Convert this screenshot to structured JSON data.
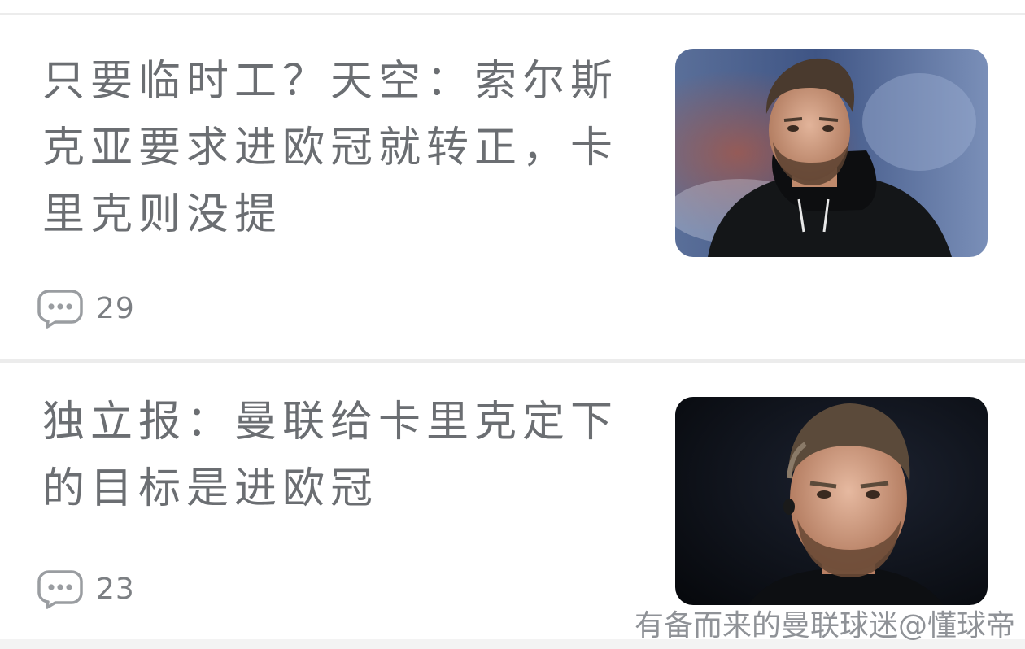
{
  "feed": {
    "items": [
      {
        "title": "只要临时工？天空：索尔斯克亚要求进欧冠就转正，卡里克则没提",
        "comment_count": "29",
        "thumbnail": "man-in-black-hooded-jacket-stadium-photo"
      },
      {
        "title": "独立报：曼联给卡里克定下的目标是进欧冠",
        "comment_count": "23",
        "thumbnail": "man-with-earpiece-dark-background-photo"
      }
    ]
  },
  "watermark": {
    "text": "有备而来的曼联球迷@懂球帝"
  },
  "icons": {
    "comment": "comment-bubble-icon"
  },
  "colors": {
    "title_text": "#6b6e72",
    "meta_text": "#7c7f83",
    "divider": "#ececec",
    "background": "#ffffff"
  }
}
